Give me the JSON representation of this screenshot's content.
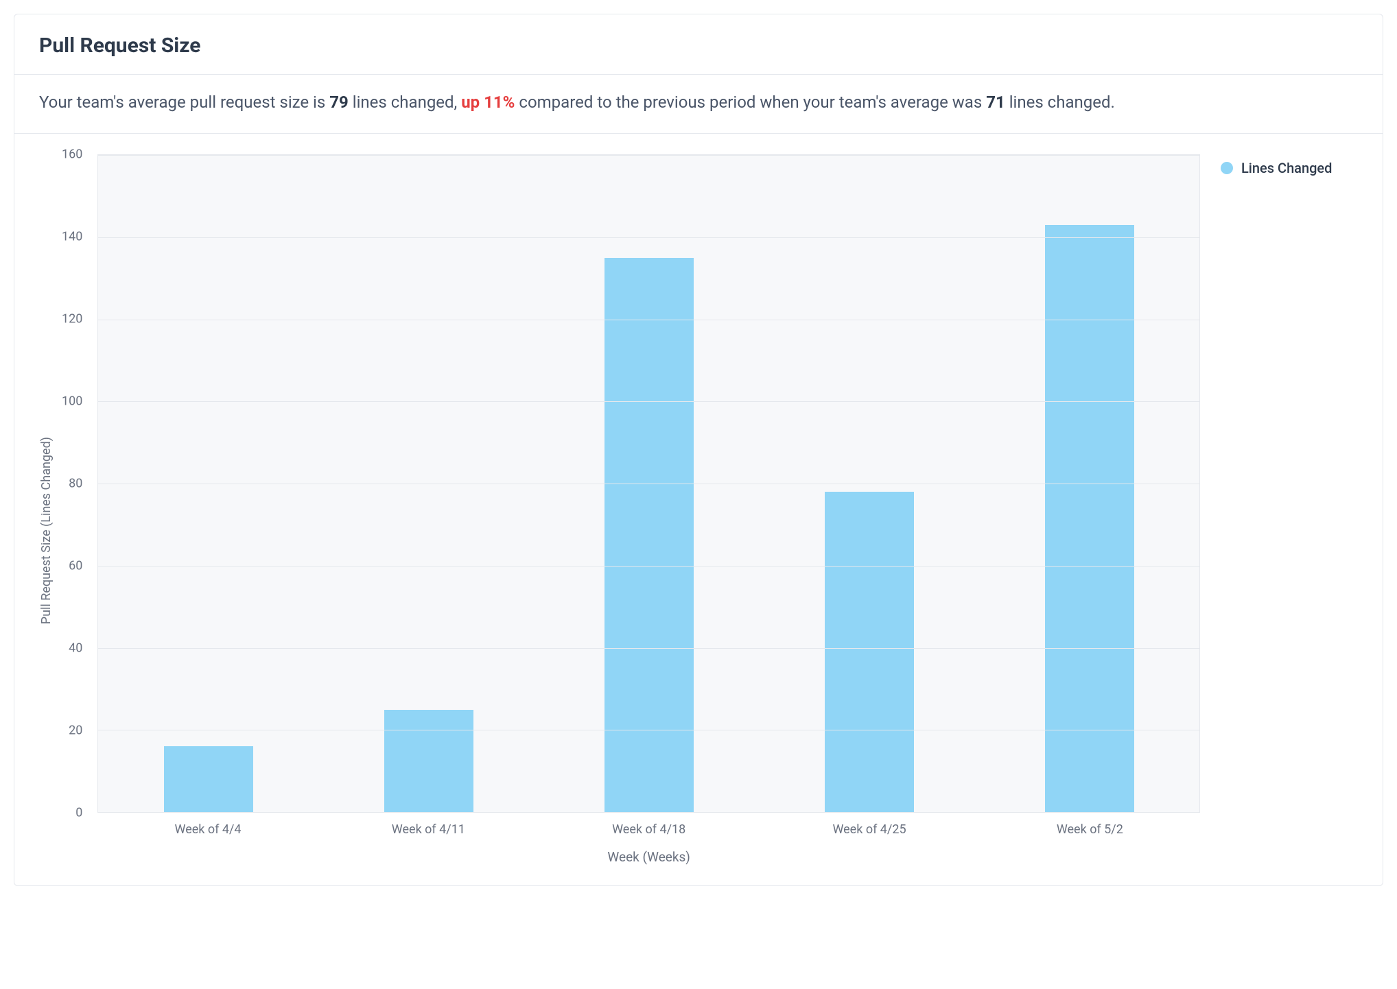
{
  "header": {
    "title": "Pull Request Size"
  },
  "summary": {
    "prefix": "Your team's average pull request size is ",
    "current_value": "79",
    "mid1": " lines changed, ",
    "delta": "up 11%",
    "mid2": " compared to the previous period when your team's average was ",
    "previous_value": "71",
    "suffix": " lines changed."
  },
  "legend": {
    "label": "Lines Changed",
    "color": "#90d5f6"
  },
  "chart_data": {
    "type": "bar",
    "title": "Pull Request Size",
    "xlabel": "Week (Weeks)",
    "ylabel": "Pull Request Size (Lines Changed)",
    "categories": [
      "Week of 4/4",
      "Week of 4/11",
      "Week of 4/18",
      "Week of 4/25",
      "Week of 5/2"
    ],
    "values": [
      16,
      25,
      135,
      78,
      143
    ],
    "ylim": [
      0,
      160
    ],
    "yticks": [
      0,
      20,
      40,
      60,
      80,
      100,
      120,
      140,
      160
    ],
    "series": [
      {
        "name": "Lines Changed",
        "values": [
          16,
          25,
          135,
          78,
          143
        ],
        "color": "#90d5f6"
      }
    ]
  }
}
